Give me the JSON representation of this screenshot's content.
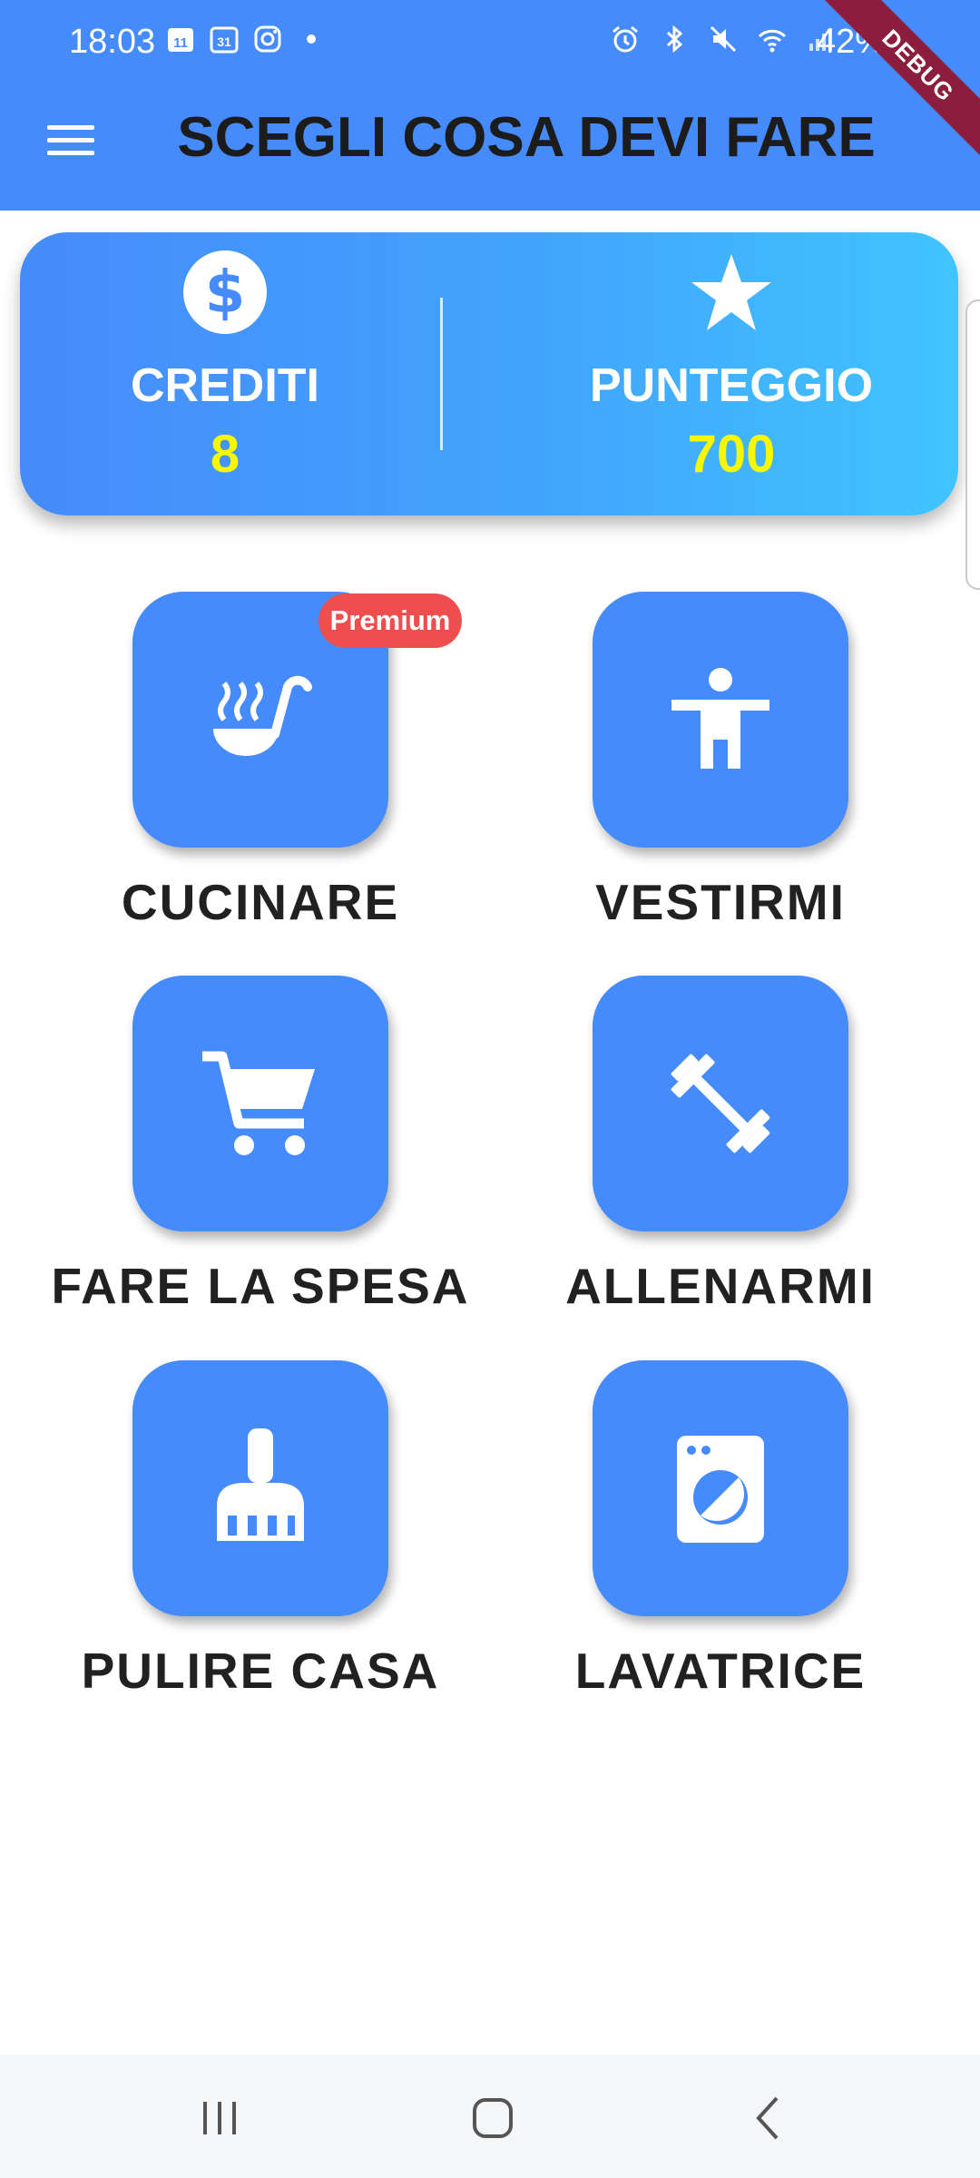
{
  "status_bar": {
    "time": "18:03",
    "calendar_day_1": "11",
    "calendar_day_2": "31",
    "battery": "42%"
  },
  "debug_banner": "DEBUG",
  "header": {
    "title": "SCEGLI COSA DEVI FARE",
    "menu_icon": "hamburger-menu-icon"
  },
  "stats": {
    "credits_label": "CREDITI",
    "credits_value": "8",
    "score_label": "PUNTEGGIO",
    "score_value": "700"
  },
  "activities": [
    {
      "label": "CUCINARE",
      "icon": "ladle-soup-icon",
      "badge": "Premium"
    },
    {
      "label": "VESTIRMI",
      "icon": "person-dressing-icon"
    },
    {
      "label": "FARE LA SPESA",
      "icon": "shopping-cart-icon"
    },
    {
      "label": "ALLENARMI",
      "icon": "dumbbell-icon"
    },
    {
      "label": "PULIRE CASA",
      "icon": "broom-icon"
    },
    {
      "label": "LAVATRICE",
      "icon": "washing-machine-icon"
    }
  ],
  "colors": {
    "primary": "#468BFB",
    "value_yellow": "#F7F700",
    "premium_red": "#EF4E4E"
  }
}
